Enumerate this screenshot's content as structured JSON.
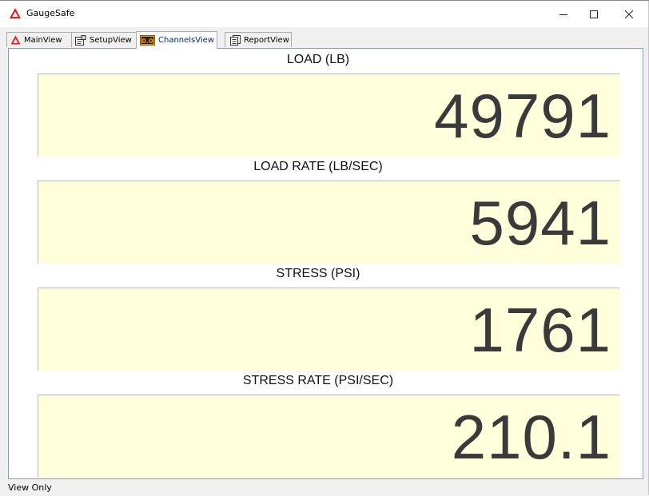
{
  "window": {
    "title": "GaugeSafe",
    "controls": [
      "minimize",
      "maximize",
      "close"
    ]
  },
  "tabs": [
    {
      "label": "MainView",
      "icon": "warning-triangle-icon",
      "active": false
    },
    {
      "label": "SetupView",
      "icon": "setup-icon",
      "active": false
    },
    {
      "label": "ChannelsView",
      "icon": "channels-icon",
      "icon_text": "0.0",
      "active": true
    },
    {
      "label": "ReportView",
      "icon": "report-icon",
      "active": false
    }
  ],
  "channels": [
    {
      "label": "LOAD (LB)",
      "value": "49791"
    },
    {
      "label": "LOAD RATE (LB/SEC)",
      "value": "5941"
    },
    {
      "label": "STRESS (PSI)",
      "value": "1761"
    },
    {
      "label": "STRESS RATE (PSI/SEC)",
      "value": "210.1"
    }
  ],
  "status": {
    "text": "View Only"
  },
  "colors": {
    "display_background": "#ffffdc",
    "logo_red": "#e02020",
    "channels_icon_orange": "#f5a000"
  }
}
